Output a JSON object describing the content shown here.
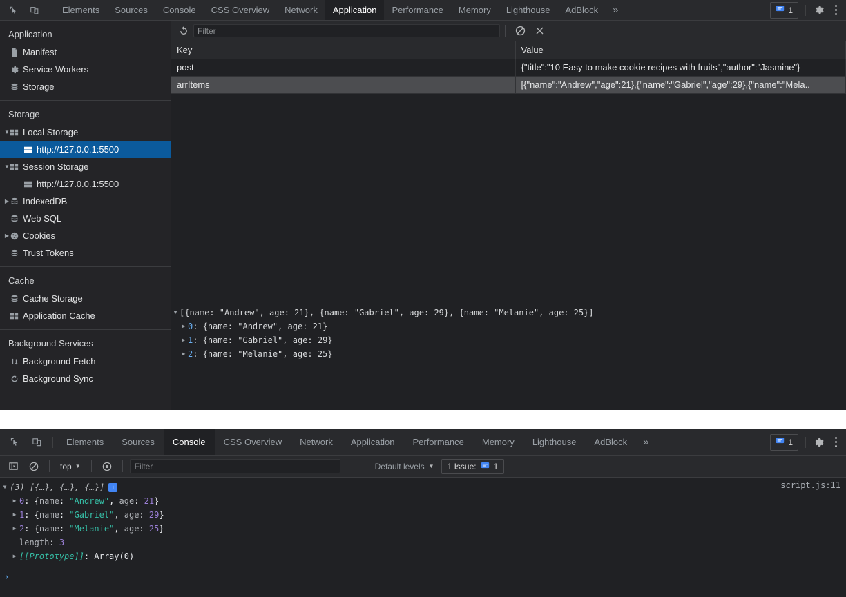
{
  "top_panel": {
    "tabbar": {
      "icons": [
        {
          "name": "inspect-element-icon"
        },
        {
          "name": "device-toolbar-icon"
        }
      ],
      "tabs": [
        {
          "label": "Elements",
          "active": false
        },
        {
          "label": "Sources",
          "active": false
        },
        {
          "label": "Console",
          "active": false
        },
        {
          "label": "CSS Overview",
          "active": false
        },
        {
          "label": "Network",
          "active": false
        },
        {
          "label": "Application",
          "active": true
        },
        {
          "label": "Performance",
          "active": false
        },
        {
          "label": "Memory",
          "active": false
        },
        {
          "label": "Lighthouse",
          "active": false
        },
        {
          "label": "AdBlock",
          "active": false
        }
      ],
      "more_label": "»",
      "issue_count": "1",
      "settings_icon": "gear-icon",
      "menu_icon": "kebab-menu-icon"
    },
    "sidebar": {
      "sections": [
        {
          "title": "Application",
          "items": [
            {
              "label": "Manifest",
              "icon": "document-icon",
              "level": 1,
              "expandable": false,
              "selected": false
            },
            {
              "label": "Service Workers",
              "icon": "gear-icon",
              "level": 1,
              "expandable": false,
              "selected": false
            },
            {
              "label": "Storage",
              "icon": "database-icon",
              "level": 1,
              "expandable": false,
              "selected": false
            }
          ]
        },
        {
          "title": "Storage",
          "items": [
            {
              "label": "Local Storage",
              "icon": "table-icon",
              "level": 1,
              "expandable": true,
              "expanded": true,
              "selected": false
            },
            {
              "label": "http://127.0.0.1:5500",
              "icon": "table-icon",
              "level": 2,
              "expandable": false,
              "selected": true
            },
            {
              "label": "Session Storage",
              "icon": "table-icon",
              "level": 1,
              "expandable": true,
              "expanded": true,
              "selected": false
            },
            {
              "label": "http://127.0.0.1:5500",
              "icon": "table-icon",
              "level": 2,
              "expandable": false,
              "selected": false
            },
            {
              "label": "IndexedDB",
              "icon": "database-icon",
              "level": 1,
              "expandable": true,
              "expanded": false,
              "selected": false
            },
            {
              "label": "Web SQL",
              "icon": "database-icon",
              "level": 1,
              "expandable": false,
              "selected": false
            },
            {
              "label": "Cookies",
              "icon": "cookie-icon",
              "level": 1,
              "expandable": true,
              "expanded": false,
              "selected": false
            },
            {
              "label": "Trust Tokens",
              "icon": "database-icon",
              "level": 1,
              "expandable": false,
              "selected": false
            }
          ]
        },
        {
          "title": "Cache",
          "items": [
            {
              "label": "Cache Storage",
              "icon": "database-icon",
              "level": 1,
              "expandable": false,
              "selected": false
            },
            {
              "label": "Application Cache",
              "icon": "table-icon",
              "level": 1,
              "expandable": false,
              "selected": false
            }
          ]
        },
        {
          "title": "Background Services",
          "items": [
            {
              "label": "Background Fetch",
              "icon": "updown-arrows-icon",
              "level": 1,
              "expandable": false,
              "selected": false
            },
            {
              "label": "Background Sync",
              "icon": "sync-icon",
              "level": 1,
              "expandable": false,
              "selected": false
            }
          ]
        }
      ]
    },
    "subtoolbar": {
      "refresh_icon": "refresh-icon",
      "filter_placeholder": "Filter",
      "filter_value": "",
      "clear_icon": "clear-all-icon",
      "delete_icon": "delete-selected-icon"
    },
    "storage_table": {
      "columns": [
        "Key",
        "Value"
      ],
      "rows": [
        {
          "key": "post",
          "value": "{\"title\":\"10 Easy to make cookie recipes with fruits\",\"author\":\"Jasmine\"}",
          "selected": false
        },
        {
          "key": "arrItems",
          "value": "[{\"name\":\"Andrew\",\"age\":21},{\"name\":\"Gabriel\",\"age\":29},{\"name\":\"Mela..",
          "selected": true
        }
      ]
    },
    "preview": {
      "root": "[{name: \"Andrew\", age: 21}, {name: \"Gabriel\", age: 29}, {name: \"Melanie\", age: 25}]",
      "children": [
        {
          "index": "0",
          "text": ": {name: \"Andrew\", age: 21}"
        },
        {
          "index": "1",
          "text": ": {name: \"Gabriel\", age: 29}"
        },
        {
          "index": "2",
          "text": ": {name: \"Melanie\", age: 25}"
        }
      ]
    }
  },
  "bottom_panel": {
    "tabbar": {
      "tabs": [
        {
          "label": "Elements",
          "active": false
        },
        {
          "label": "Sources",
          "active": false
        },
        {
          "label": "Console",
          "active": true
        },
        {
          "label": "CSS Overview",
          "active": false
        },
        {
          "label": "Network",
          "active": false
        },
        {
          "label": "Application",
          "active": false
        },
        {
          "label": "Performance",
          "active": false
        },
        {
          "label": "Memory",
          "active": false
        },
        {
          "label": "Lighthouse",
          "active": false
        },
        {
          "label": "AdBlock",
          "active": false
        }
      ],
      "more_label": "»",
      "issue_count": "1"
    },
    "toolbar": {
      "sidebar_icon": "console-sidebar-icon",
      "clear_icon": "clear-console-icon",
      "context": "top",
      "eye_icon": "live-expression-icon",
      "filter_placeholder": "Filter",
      "filter_value": "",
      "levels_label": "Default levels",
      "issues_label": "1 Issue:",
      "issues_count": "1"
    },
    "output": {
      "source_link": "script.js:11",
      "header": "(3) [{…}, {…}, {…}]",
      "rows": [
        {
          "index": "0",
          "prefix": ": {",
          "key1": "name",
          "sep1": ": ",
          "str": "\"Andrew\"",
          "comma": ", ",
          "key2": "age",
          "sep2": ": ",
          "num": "21",
          "suffix": "}"
        },
        {
          "index": "1",
          "prefix": ": {",
          "key1": "name",
          "sep1": ": ",
          "str": "\"Gabriel\"",
          "comma": ", ",
          "key2": "age",
          "sep2": ": ",
          "num": "29",
          "suffix": "}"
        },
        {
          "index": "2",
          "prefix": ": {",
          "key1": "name",
          "sep1": ": ",
          "str": "\"Melanie\"",
          "comma": ", ",
          "key2": "age",
          "sep2": ": ",
          "num": "25",
          "suffix": "}"
        }
      ],
      "length_label": "length",
      "length_value": "3",
      "proto_label": "[[Prototype]]",
      "proto_value": ": Array(0)",
      "prompt": "›"
    }
  },
  "colors": {
    "accent_blue": "#0b5a9c",
    "tab_active_text": "#ffffff",
    "panel_bg": "#202124",
    "toolbar_bg": "#292a2d",
    "sidebar_bg": "#242427",
    "string_green": "#36bea6",
    "number_purple": "#9a7fd6",
    "info_badge_blue": "#4285f4",
    "prompt_blue": "#5b9dd9"
  }
}
